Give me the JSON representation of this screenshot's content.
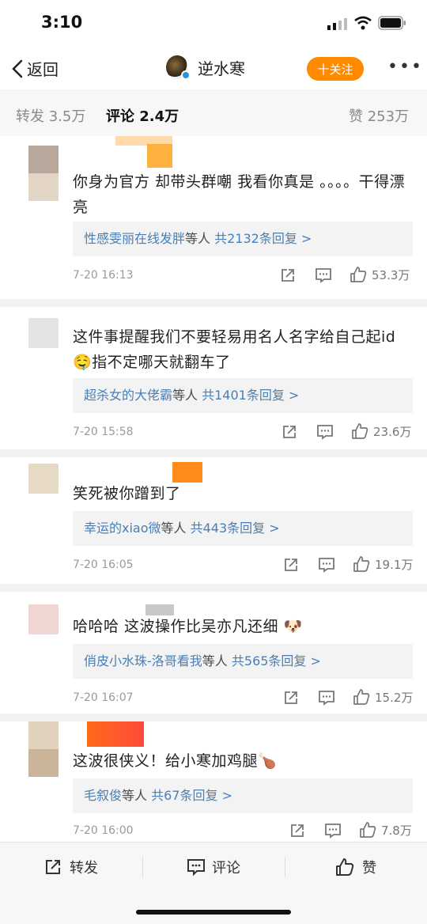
{
  "status_bar": {
    "time": "3:10"
  },
  "nav": {
    "back_label": "返回",
    "title": "逆水寒",
    "follow_label": "十关注",
    "more_label": "•••"
  },
  "tabs": [
    {
      "label": "转发 3.5万"
    },
    {
      "label": "评论 2.4万"
    },
    {
      "label": "赞 253万"
    }
  ],
  "comments": [
    {
      "text": "你身为官方 却带头群嘲 我看你真是 。。。。干得漂亮",
      "reply_names": "性感雯丽在线发胖",
      "reply_mid": "等人",
      "reply_count": "共2132条回复 >",
      "time": "7-20 16:13",
      "likes": "53.3万"
    },
    {
      "text": "这件事提醒我们不要轻易用名人名字给自己起id",
      "text2": "指不定哪天就翻车了",
      "emoji": "🤤",
      "reply_names": "超杀女的大佬霸",
      "reply_mid": "等人",
      "reply_count": "共1401条回复 >",
      "time": "7-20 15:58",
      "likes": "23.6万"
    },
    {
      "text": "笑死被你蹭到了",
      "reply_names": "幸运的xiao微",
      "reply_mid": "等人",
      "reply_count": "共443条回复 >",
      "time": "7-20 16:05",
      "likes": "19.1万"
    },
    {
      "text": "哈哈哈 这波操作比吴亦凡还细",
      "emoji": "🐶",
      "reply_names": "俏皮小水珠-洛哥看我",
      "reply_mid": "等人",
      "reply_count": "共565条回复 >",
      "time": "7-20 16:07",
      "likes": "15.2万"
    },
    {
      "text": "这波很侠义！给小寒加鸡腿",
      "emoji": "🍗",
      "reply_names": "毛叙俊",
      "reply_mid": "等人",
      "reply_count": "共67条回复 >",
      "time": "7-20 16:00",
      "likes": "7.8万"
    }
  ],
  "bottom_bar": {
    "repost_label": "转发",
    "comment_label": "评论",
    "like_label": "赞"
  },
  "colors": {
    "accent": "#ff8a00",
    "link": "#4a7fb5",
    "verified": "#2b8fe0"
  },
  "icons": [
    "back-chevron-icon",
    "verified-icon",
    "more-icon",
    "share-icon",
    "comment-icon",
    "like-icon",
    "signal-icon",
    "wifi-icon",
    "battery-icon"
  ]
}
